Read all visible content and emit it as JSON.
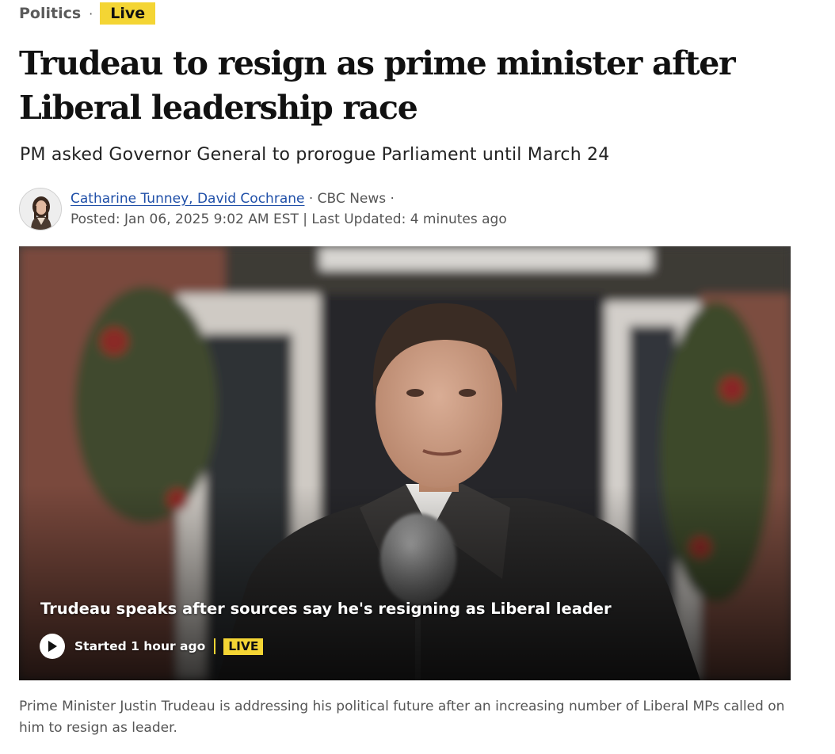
{
  "breadcrumb": {
    "section": "Politics",
    "separator": "·",
    "live_label": "Live"
  },
  "headline": "Trudeau to resign as prime minister after Liberal leadership race",
  "deck": "PM asked Governor General to prorogue Parliament until March 24",
  "byline": {
    "authors": "Catharine Tunney, David Cochrane",
    "outlet": "· CBC News ·",
    "dates": "Posted: Jan 06, 2025 9:02 AM EST | Last Updated: 4 minutes ago"
  },
  "video": {
    "title": "Trudeau speaks after sources say he's resigning as Liberal leader",
    "started": "Started 1 hour ago",
    "live_badge": "LIVE"
  },
  "caption": "Prime Minister Justin Trudeau is addressing his political future after an increasing number of Liberal MPs called on him to resign as leader.",
  "colors": {
    "live_yellow": "#f4d534",
    "author_link": "#1f4fa8",
    "muted_text": "#555555"
  },
  "icons": {
    "play": "play-icon"
  }
}
